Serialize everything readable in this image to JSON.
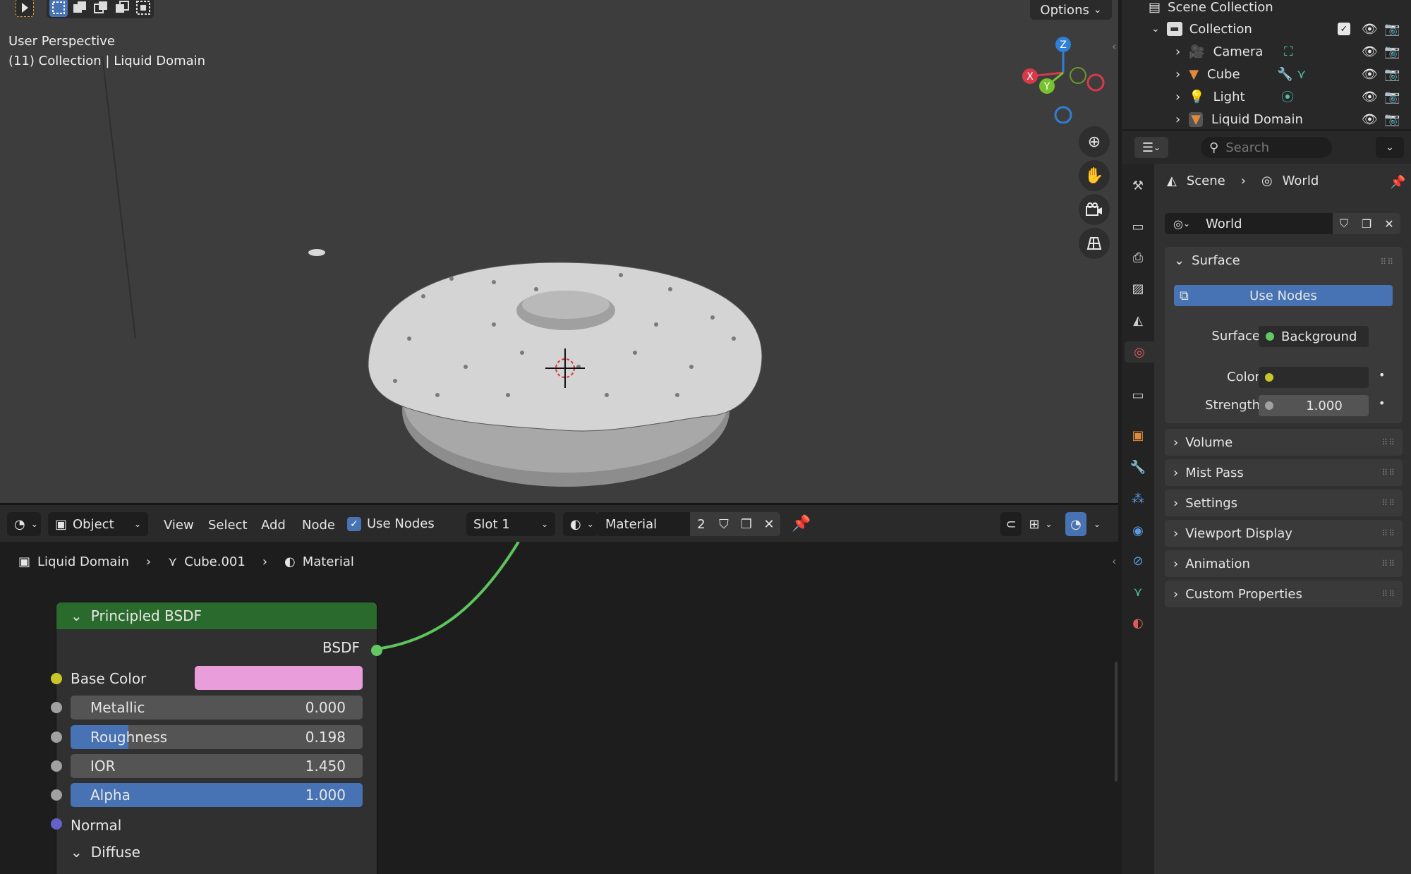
{
  "viewport": {
    "perspective_label": "User Perspective",
    "collection_label": "(11) Collection | Liquid Domain",
    "options_label": "Options",
    "axis_x": "X",
    "axis_y": "Y",
    "axis_z": "Z"
  },
  "node_header": {
    "editor_type_icon": "node-editor-icon",
    "object_mode": "Object",
    "menus": [
      "View",
      "Select",
      "Add",
      "Node"
    ],
    "use_nodes_label": "Use Nodes",
    "use_nodes_checked": true,
    "slot": "Slot 1",
    "material_name": "Material",
    "material_users": "2"
  },
  "breadcrumb": {
    "object": "Liquid Domain",
    "mesh": "Cube.001",
    "material": "Material"
  },
  "node": {
    "title": "Principled BSDF",
    "output": "BSDF",
    "base_color_label": "Base Color",
    "base_color_value": "#e99edb",
    "fields": [
      {
        "label": "Metallic",
        "value": "0.000",
        "fill": 0.0
      },
      {
        "label": "Roughness",
        "value": "0.198",
        "fill": 0.198
      },
      {
        "label": "IOR",
        "value": "1.450",
        "fill": 0.0
      },
      {
        "label": "Alpha",
        "value": "1.000",
        "fill": 1.0
      }
    ],
    "normal_label": "Normal",
    "diffuse_label": "Diffuse"
  },
  "outliner": {
    "scene_collection": "Scene Collection",
    "collection": "Collection",
    "items": [
      "Camera",
      "Cube",
      "Light",
      "Liquid Domain"
    ]
  },
  "properties": {
    "search_placeholder": "Search",
    "breadcrumb_scene": "Scene",
    "breadcrumb_world": "World",
    "world_name": "World",
    "surface_panel": "Surface",
    "use_nodes_button": "Use Nodes",
    "surface_label": "Surface",
    "surface_value": "Background",
    "color_label": "Color",
    "color_value": "#2b2b2b",
    "strength_label": "Strength",
    "strength_value": "1.000",
    "panels": [
      "Volume",
      "Mist Pass",
      "Settings",
      "Viewport Display",
      "Animation",
      "Custom Properties"
    ]
  },
  "colors": {
    "accent_blue": "#4772b3",
    "node_header_green": "#2b6a2d",
    "socket_yellow": "#c7c729",
    "socket_grey": "#a1a1a1",
    "socket_purple": "#6363c7",
    "socket_green": "#63c763"
  }
}
